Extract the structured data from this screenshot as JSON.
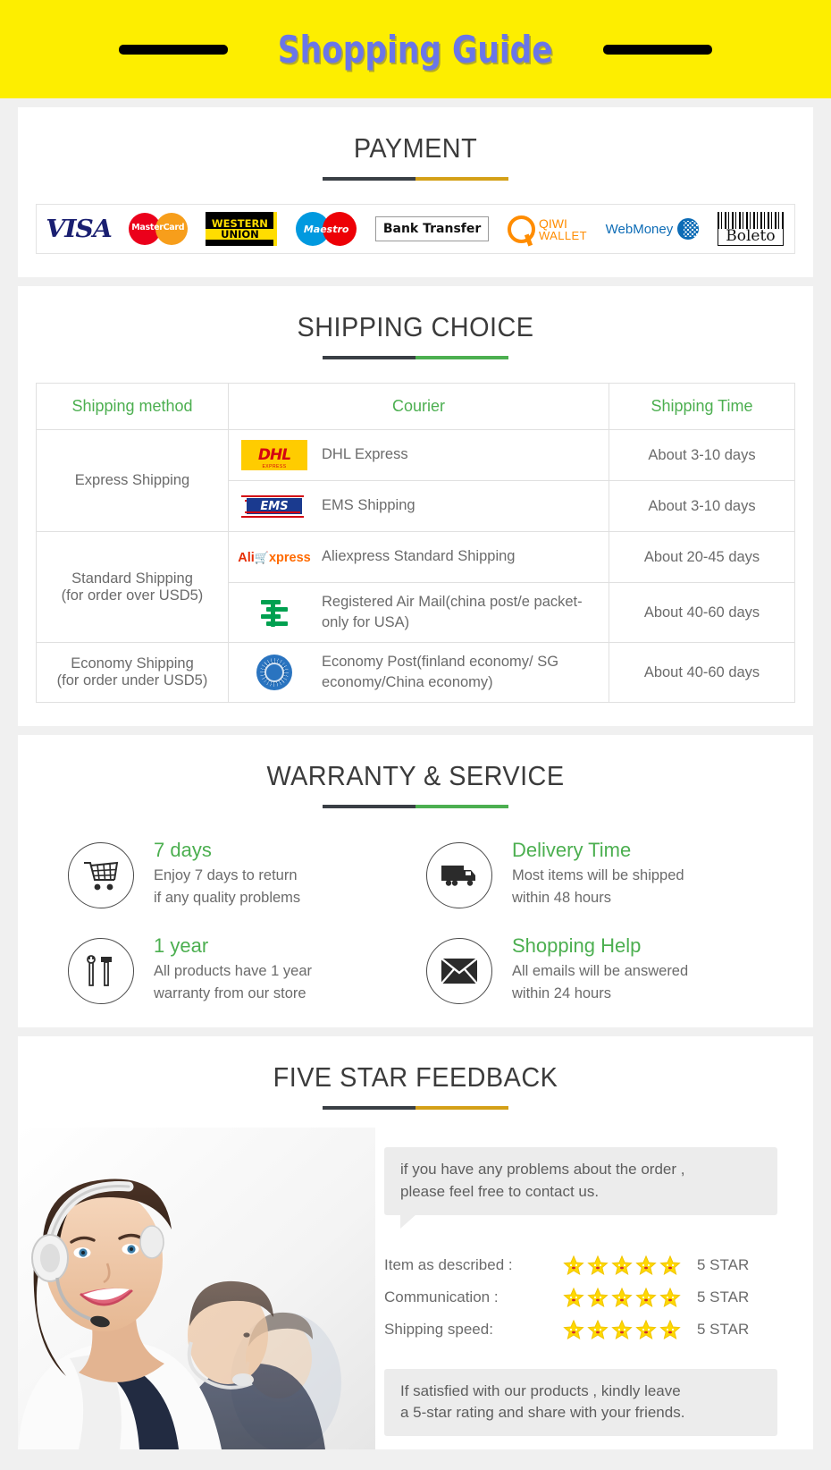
{
  "banner": {
    "title": "Shopping Guide"
  },
  "payment": {
    "title": "PAYMENT",
    "methods": [
      {
        "name": "visa-logo",
        "label": "VISA"
      },
      {
        "name": "mastercard-logo",
        "label": "MasterCard"
      },
      {
        "name": "western-union-logo",
        "label_top": "WESTERN",
        "label_bottom": "UNION"
      },
      {
        "name": "maestro-logo",
        "label": "Maestro"
      },
      {
        "name": "bank-transfer-logo",
        "label": "Bank Transfer"
      },
      {
        "name": "qiwi-wallet-logo",
        "label_top": "QIWI",
        "label_bottom": "WALLET"
      },
      {
        "name": "webmoney-logo",
        "label": "WebMoney"
      },
      {
        "name": "boleto-logo",
        "label": "Boleto"
      }
    ]
  },
  "shipping": {
    "title": "SHIPPING CHOICE",
    "headers": [
      "Shipping method",
      "Courier",
      "Shipping Time"
    ],
    "rows": [
      {
        "method": "Express Shipping",
        "couriers": [
          {
            "logo": "dhl-logo",
            "name": "DHL Express",
            "time": "About 3-10 days"
          },
          {
            "logo": "ems-logo",
            "name": "EMS Shipping",
            "time": "About 3-10 days"
          }
        ]
      },
      {
        "method": "Standard Shipping\n(for order over USD5)",
        "method_line1": "Standard Shipping",
        "method_line2": "(for order over USD5)",
        "couriers": [
          {
            "logo": "aliexpress-logo",
            "name": "Aliexpress Standard Shipping",
            "time": "About 20-45 days"
          },
          {
            "logo": "china-post-logo",
            "name": "Registered Air Mail(china post/e packet-only for USA)",
            "time": "About 40-60 days"
          }
        ]
      },
      {
        "method_line1": "Economy Shipping",
        "method_line2": "(for order under USD5)",
        "couriers": [
          {
            "logo": "un-logo",
            "name": "Economy Post(finland economy/ SG economy/China economy)",
            "time": "About 40-60 days"
          }
        ]
      }
    ]
  },
  "warranty": {
    "title": "WARRANTY & SERVICE",
    "items": [
      {
        "icon": "shopping-cart-icon",
        "title": "7 days",
        "line1": "Enjoy 7 days to return",
        "line2": "if any quality problems"
      },
      {
        "icon": "delivery-truck-icon",
        "title": "Delivery Time",
        "line1": "Most items will be shipped",
        "line2": "within 48 hours"
      },
      {
        "icon": "tools-icon",
        "title": "1 year",
        "line1": "All products have 1 year",
        "line2": "warranty from our store"
      },
      {
        "icon": "envelope-icon",
        "title": "Shopping Help",
        "line1": "All emails will be answered",
        "line2": "within 24 hours"
      }
    ]
  },
  "feedback": {
    "title": "FIVE STAR FEEDBACK",
    "bubble_top_line1": "if you have any problems about the order ,",
    "bubble_top_line2": "please feel free to contact us.",
    "ratings": [
      {
        "label": "Item as described :",
        "stars": 5,
        "value": "5 STAR"
      },
      {
        "label": "Communication :",
        "stars": 5,
        "value": "5 STAR"
      },
      {
        "label": "Shipping speed:",
        "stars": 5,
        "value": "5 STAR"
      }
    ],
    "bubble_bottom_line1": "If satisfied with our products ,  kindly leave",
    "bubble_bottom_line2": "a 5-star rating and share with your friends."
  },
  "colors": {
    "banner_bg": "#fdee00",
    "banner_text": "#6a76e8",
    "green": "#4caf50",
    "gold": "#d4a017",
    "dark": "#3a3f45",
    "body_text": "#6b6b6b"
  }
}
